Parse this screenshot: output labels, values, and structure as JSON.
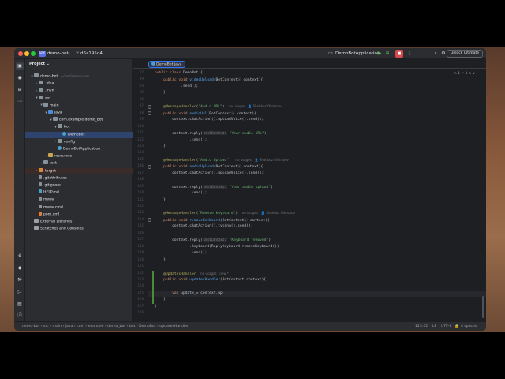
{
  "titlebar": {
    "project_badge": "DB",
    "project_name": "demo-bot",
    "branch": "d6a195d4",
    "run_config": "DemoBotApplication",
    "unlock_label": "Unlock Ultimate"
  },
  "project_panel": {
    "title": "Project",
    "tree": [
      {
        "indent": 1,
        "arrow": "▾",
        "icon": "folder",
        "label": "demo-bot",
        "hint": "~/bot/demo-bot"
      },
      {
        "indent": 2,
        "arrow": "›",
        "icon": "folder",
        "label": ".idea",
        "hint": ""
      },
      {
        "indent": 2,
        "arrow": "›",
        "icon": "folder",
        "label": ".mvn",
        "hint": ""
      },
      {
        "indent": 2,
        "arrow": "▾",
        "icon": "folder",
        "label": "src",
        "hint": ""
      },
      {
        "indent": 3,
        "arrow": "▾",
        "icon": "folder",
        "label": "main",
        "hint": ""
      },
      {
        "indent": 4,
        "arrow": "▾",
        "icon": "src",
        "label": "java",
        "hint": ""
      },
      {
        "indent": 5,
        "arrow": "▾",
        "icon": "folder",
        "label": "com.example.demo_bot",
        "hint": ""
      },
      {
        "indent": 6,
        "arrow": "▾",
        "icon": "folder",
        "label": "bot",
        "hint": ""
      },
      {
        "indent": 7,
        "arrow": "",
        "icon": "cls",
        "label": "DemoBot",
        "hint": "",
        "selected": true
      },
      {
        "indent": 6,
        "arrow": "›",
        "icon": "folder",
        "label": "config",
        "hint": ""
      },
      {
        "indent": 6,
        "arrow": "",
        "icon": "cls",
        "label": "DemoBotApplication",
        "hint": ""
      },
      {
        "indent": 4,
        "arrow": "›",
        "icon": "res",
        "label": "resources",
        "hint": ""
      },
      {
        "indent": 3,
        "arrow": "›",
        "icon": "folder",
        "label": "test",
        "hint": ""
      },
      {
        "indent": 2,
        "arrow": "›",
        "icon": "tgt",
        "label": "target",
        "hint": "",
        "highlight": true
      },
      {
        "indent": 2,
        "arrow": "",
        "icon": "file",
        "label": ".gitattributes",
        "hint": ""
      },
      {
        "indent": 2,
        "arrow": "",
        "icon": "file",
        "label": ".gitignore",
        "hint": ""
      },
      {
        "indent": 2,
        "arrow": "",
        "icon": "md",
        "label": "HELP.md",
        "hint": ""
      },
      {
        "indent": 2,
        "arrow": "",
        "icon": "file",
        "label": "mvnw",
        "hint": ""
      },
      {
        "indent": 2,
        "arrow": "",
        "icon": "file",
        "label": "mvnw.cmd",
        "hint": ""
      },
      {
        "indent": 2,
        "arrow": "",
        "icon": "xml",
        "label": "pom.xml",
        "hint": ""
      },
      {
        "indent": 1,
        "arrow": "›",
        "icon": "lib",
        "label": "External Libraries",
        "hint": ""
      },
      {
        "indent": 1,
        "arrow": "",
        "icon": "lib",
        "label": "Scratches and Consoles",
        "hint": ""
      }
    ]
  },
  "editor": {
    "tab_label": "DemoBot.java",
    "warnings": "⚠ 1  ✓ 1  ∧  ∨",
    "lines": [
      {
        "n": "17",
        "html": "<span class='kw'>public class </span>DemoBot {"
      },
      {
        "n": "99",
        "html": "    <span class='kw'>public void </span><span class='fn'>videoUpload</span>(BotContext<span class='hint'>↑</span> context){"
      },
      {
        "n": "94",
        "html": "            .send();"
      },
      {
        "n": "95",
        "html": "    }"
      },
      {
        "n": "96",
        "html": ""
      },
      {
        "n": "97",
        "html": "    <span class='an'>@MessageHandler</span>(<span class='st'>\"Audio URL\"</span>)  <span class='author'>no usages   👤 Shahboz Olimzoov</span>",
        "mark": true
      },
      {
        "n": "98",
        "html": "    <span class='kw'>public void </span><span class='fn'>audioUrl</span>(BotContext<span class='hint'>↑</span> context){",
        "mark": true
      },
      {
        "n": "99",
        "html": "        context.chatAction().uploadVoice().send();"
      },
      {
        "n": "100",
        "html": ""
      },
      {
        "n": "101",
        "html": "        context.reply(<span class='hint'>textContext:</span> <span class='st'>\"Your audio URL\"</span>)"
      },
      {
        "n": "102",
        "html": "                .send();"
      },
      {
        "n": "103",
        "html": "    }"
      },
      {
        "n": "104",
        "html": ""
      },
      {
        "n": "105",
        "html": "    <span class='an'>@MessageHandler</span>(<span class='st'>\"Audio Upload\"</span>)  <span class='author'>no usages   👤 Shahboz Olimzoov</span>"
      },
      {
        "n": "106",
        "html": "    <span class='kw'>public void </span><span class='fn'>audioUpload</span>(BotContext<span class='hint'>↑</span> context){",
        "mark": true
      },
      {
        "n": "107",
        "html": "        context.chatAction().uploadVoice().send();"
      },
      {
        "n": "108",
        "html": ""
      },
      {
        "n": "109",
        "html": "        context.reply(<span class='hint'>textContext:</span> <span class='st'>\"Your audio upload\"</span>)"
      },
      {
        "n": "110",
        "html": "                .send();"
      },
      {
        "n": "111",
        "html": "    }"
      },
      {
        "n": "112",
        "html": ""
      },
      {
        "n": "113",
        "html": "    <span class='an'>@MessageHandler</span>(<span class='st'>\"Remove keyboard\"</span>)  <span class='author'>no usages   👤 Shahboz Olimzoov</span>"
      },
      {
        "n": "114",
        "html": "    <span class='kw'>public void </span><span class='fn'>removeKeyboard</span>(BotContext<span class='hint'>↑</span> context){",
        "mark": true
      },
      {
        "n": "115",
        "html": "        context.chatAction().typing().send();"
      },
      {
        "n": "116",
        "html": ""
      },
      {
        "n": "117",
        "html": "        context.reply(<span class='hint'>textContext:</span> <span class='st'>\"Keyboard removed\"</span>)"
      },
      {
        "n": "118",
        "html": "                .keyboard(ReplyKeyboard.removeKeyboard())"
      },
      {
        "n": "119",
        "html": "                .send();"
      },
      {
        "n": "120",
        "html": "    }"
      },
      {
        "n": "121",
        "html": ""
      },
      {
        "n": "122",
        "html": "    <span class='an'>@UpdatesHandler</span>  <span class='author'>no usages   new *</span>"
      },
      {
        "n": "123",
        "html": "    <span class='kw'>public void </span><span class='fn'>updatesHandler</span>(BotContext context){"
      },
      {
        "n": "124",
        "html": ""
      },
      {
        "n": "125",
        "html": "        <span class='kw'>var </span>update_= context.up",
        "caret": true
      },
      {
        "n": "126",
        "html": "    }"
      },
      {
        "n": "127",
        "html": "}"
      },
      {
        "n": "128",
        "html": ""
      }
    ]
  },
  "statusbar": {
    "breadcrumbs": "demo-bot  ›  src  ›  main  ›  java  ›  com  ›  example  ›  demo_bot  ›  bot  ›  DemoBot  ›  updatesHandler",
    "position": "125:32",
    "line_sep": "LF",
    "encoding": "UTF-8",
    "indent": "4 spaces"
  }
}
